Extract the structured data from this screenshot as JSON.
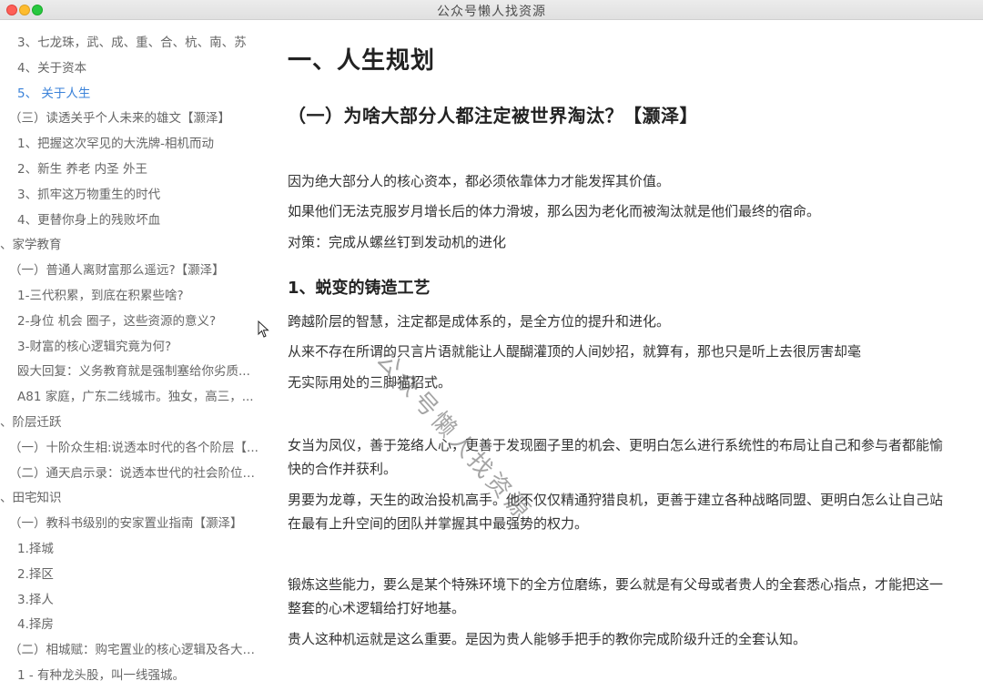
{
  "window": {
    "title": "公众号懒人找资源"
  },
  "sidebar": {
    "items": [
      {
        "label": "3、七龙珠，武、成、重、合、杭、南、苏",
        "level": 3,
        "active": false
      },
      {
        "label": "4、关于资本",
        "level": 3,
        "active": false
      },
      {
        "label": "5、 关于人生",
        "level": 3,
        "active": true
      },
      {
        "label": "（三）读透关乎个人未来的雄文【灏泽】",
        "level": 2,
        "active": false
      },
      {
        "label": "1、把握这次罕见的大洗牌-相机而动",
        "level": 3,
        "active": false
      },
      {
        "label": "2、新生 养老 内圣 外王",
        "level": 3,
        "active": false
      },
      {
        "label": "3、抓牢这万物重生的时代",
        "level": 3,
        "active": false
      },
      {
        "label": "4、更替你身上的残败坏血",
        "level": 3,
        "active": false
      },
      {
        "label": "、家学教育",
        "level": 1,
        "active": false
      },
      {
        "label": "（一）普通人离财富那么遥远?【灏泽】",
        "level": 2,
        "active": false
      },
      {
        "label": "1-三代积累，到底在积累些啥?",
        "level": 3,
        "active": false
      },
      {
        "label": "2-身位 机会 圈子，这些资源的意义?",
        "level": 3,
        "active": false
      },
      {
        "label": "3-财富的核心逻辑究竟为何?",
        "level": 3,
        "active": false
      },
      {
        "label": "殴大回复：义务教育就是强制塞给你劣质...",
        "level": 3,
        "active": false
      },
      {
        "label": "A81 家庭，广东二线城市。独女，高三，...",
        "level": 3,
        "active": false
      },
      {
        "label": "、阶层迁跃",
        "level": 1,
        "active": false
      },
      {
        "label": "（一）十阶众生相:说透本时代的各个阶层【...",
        "level": 2,
        "active": false
      },
      {
        "label": "（二）通天启示录：说透本世代的社会阶位及...",
        "level": 2,
        "active": false
      },
      {
        "label": "、田宅知识",
        "level": 1,
        "active": false
      },
      {
        "label": "（一）教科书级别的安家置业指南【灏泽】",
        "level": 2,
        "active": false
      },
      {
        "label": "1.择城",
        "level": 3,
        "active": false
      },
      {
        "label": "2.择区",
        "level": 3,
        "active": false
      },
      {
        "label": "3.择人",
        "level": 3,
        "active": false
      },
      {
        "label": "4.择房",
        "level": 3,
        "active": false
      },
      {
        "label": "（二）相城赋：购宅置业的核心逻辑及各大城...",
        "level": 2,
        "active": false
      },
      {
        "label": "1 - 有种龙头股，叫一线强城。",
        "level": 3,
        "active": false
      }
    ]
  },
  "content": {
    "h1": "一、人生规划",
    "h2": "（一）为啥大部分人都注定被世界淘汰？【灏泽】",
    "h3": "1、蜕变的铸造工艺",
    "p1": "因为绝大部分人的核心资本，都必须依靠体力才能发挥其价值。",
    "p2": "如果他们无法克服岁月增长后的体力滑坡，那么因为老化而被淘汰就是他们最终的宿命。",
    "p3": "对策：完成从螺丝钉到发动机的进化",
    "p4": "跨越阶层的智慧，注定都是成体系的，是全方位的提升和进化。",
    "p5a": "从来不存在所谓的只言片语就能让人醍醐灌顶的人间妙招，就算有，那也只是听上去很厉害却毫",
    "p5b": "无实际用处的三脚猫招式。",
    "p6": "女当为凤仪，善于笼络人心，更善于发现圈子里的机会、更明白怎么进行系统性的布局让自己和参与者都能愉快的合作并获利。",
    "p7": "男要为龙尊，天生的政治投机高手。他不仅仅精通狩猎良机，更善于建立各种战略同盟、更明白怎么让自己站在最有上升空间的团队并掌握其中最强势的权力。",
    "p8": "锻炼这些能力，要么是某个特殊环境下的全方位磨练，要么就是有父母或者贵人的全套悉心指点，才能把这一整套的心术逻辑给打好地基。",
    "p9": "贵人这种机运就是这么重要。是因为贵人能够手把手的教你完成阶级升迁的全套认知。"
  },
  "watermark": "公众号懒人找资源",
  "colors": {
    "active": "#3a82d9",
    "text": "#333333",
    "muted": "#666666"
  }
}
